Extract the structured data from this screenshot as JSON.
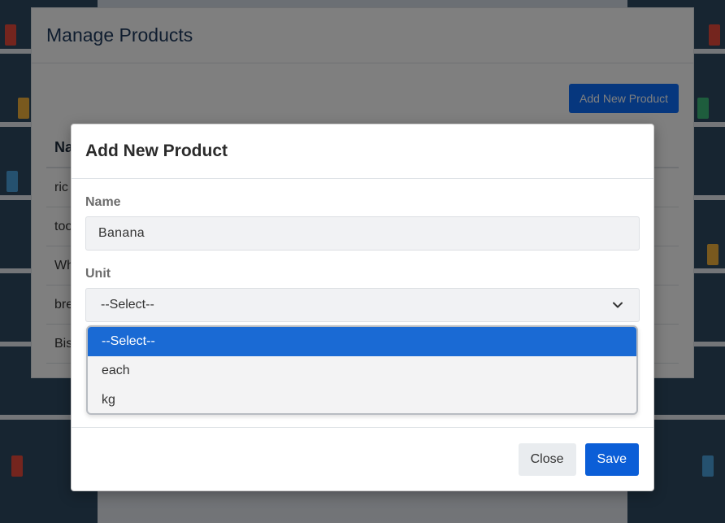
{
  "page": {
    "title": "Manage Products",
    "add_button_label": "Add New Product",
    "table": {
      "header": "Na",
      "rows": [
        "ric",
        "too",
        "Wh",
        "bre",
        "Bis"
      ]
    }
  },
  "modal": {
    "title": "Add New Product",
    "name_label": "Name",
    "name_value": "Banana",
    "unit_label": "Unit",
    "unit_selected": "--Select--",
    "unit_options": [
      "--Select--",
      "each",
      "kg"
    ],
    "close_label": "Close",
    "save_label": "Save"
  },
  "icons": {
    "select_chevron": "chevron-down-icon"
  },
  "colors": {
    "primary": "#0b5ed7",
    "option_highlight": "#1a6ad4",
    "title": "#1f3a5f"
  }
}
